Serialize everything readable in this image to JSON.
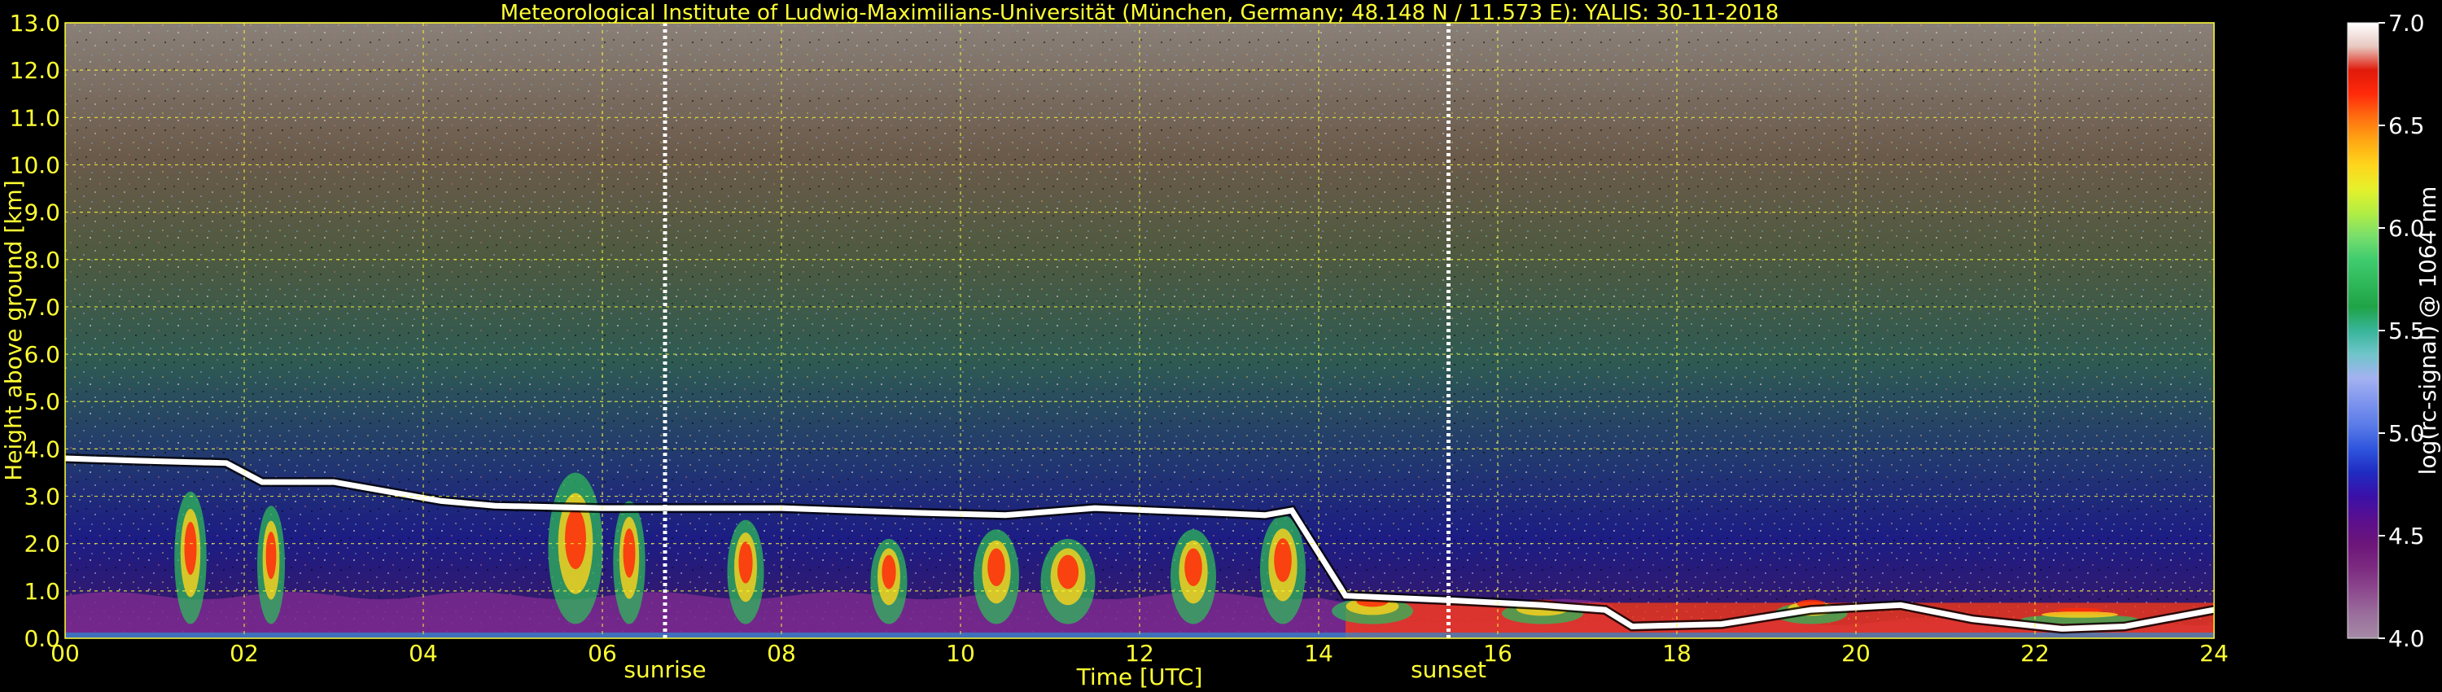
{
  "chart_data": {
    "type": "heatmap",
    "title": "Meteorological Institute of Ludwig-Maximilians-Universität (München, Germany; 48.148 N / 11.573 E):    YALIS: 30-11-2018",
    "xlabel": "Time [UTC]",
    "ylabel": "Height above ground [km]",
    "x_range": [
      0,
      24
    ],
    "y_range": [
      0,
      13
    ],
    "x_ticks": [
      "00",
      "02",
      "04",
      "06",
      "08",
      "10",
      "12",
      "14",
      "16",
      "18",
      "20",
      "22",
      "24"
    ],
    "y_ticks": [
      "0.0",
      "1.0",
      "2.0",
      "3.0",
      "4.0",
      "5.0",
      "6.0",
      "7.0",
      "8.0",
      "9.0",
      "10.0",
      "11.0",
      "12.0",
      "13.0"
    ],
    "grid": true,
    "colorbar": {
      "label": "log(rc-signal) @ 1064 nm",
      "range": [
        4.0,
        7.0
      ],
      "ticks": [
        "4.0",
        "4.5",
        "5.0",
        "5.5",
        "6.0",
        "6.5",
        "7.0"
      ],
      "colors": [
        "#a58aa5",
        "#9a6f9c",
        "#8d4a8e",
        "#7b2a80",
        "#6c157a",
        "#5a0f8e",
        "#3a10a8",
        "#1f2bc2",
        "#2f55dd",
        "#5b7be8",
        "#7f95ee",
        "#a3b2f1",
        "#6fc5c9",
        "#38b59a",
        "#1fa347",
        "#2fb85a",
        "#3fcc6f",
        "#7adf6b",
        "#b4ee43",
        "#e6f02a",
        "#ffd51c",
        "#ffa813",
        "#ff6f10",
        "#ff2a0a",
        "#e01a0a",
        "#e8c8c0",
        "#ffffff"
      ]
    },
    "events": [
      {
        "label": "sunrise",
        "x": 6.7
      },
      {
        "label": "sunset",
        "x": 15.45
      }
    ],
    "features": {
      "cloud_top_km": [
        [
          0.0,
          3.8
        ],
        [
          0.8,
          3.75
        ],
        [
          1.8,
          3.7
        ],
        [
          2.2,
          3.3
        ],
        [
          3.0,
          3.3
        ],
        [
          4.2,
          2.9
        ],
        [
          4.8,
          2.8
        ],
        [
          6.0,
          2.75
        ],
        [
          7.0,
          2.75
        ],
        [
          8.0,
          2.75
        ],
        [
          9.5,
          2.65
        ],
        [
          10.5,
          2.6
        ],
        [
          11.5,
          2.75
        ],
        [
          12.8,
          2.65
        ],
        [
          13.4,
          2.6
        ],
        [
          13.7,
          2.7
        ],
        [
          14.3,
          0.9
        ],
        [
          15.5,
          0.8
        ],
        [
          16.5,
          0.7
        ],
        [
          17.2,
          0.6
        ],
        [
          17.5,
          0.25
        ],
        [
          18.5,
          0.3
        ],
        [
          19.5,
          0.6
        ],
        [
          20.5,
          0.7
        ],
        [
          21.3,
          0.4
        ],
        [
          22.3,
          0.2
        ],
        [
          23.0,
          0.25
        ],
        [
          24.0,
          0.6
        ]
      ],
      "hot_plumes": [
        [
          1.4,
          2.8,
          0.25
        ],
        [
          2.3,
          2.5,
          0.2
        ],
        [
          5.7,
          3.2,
          0.5
        ],
        [
          6.3,
          2.6,
          0.25
        ],
        [
          7.6,
          2.2,
          0.3
        ],
        [
          9.2,
          1.8,
          0.3
        ],
        [
          10.4,
          2.0,
          0.4
        ],
        [
          11.2,
          1.8,
          0.5
        ],
        [
          12.6,
          2.0,
          0.4
        ],
        [
          13.6,
          2.3,
          0.4
        ],
        [
          14.6,
          0.55,
          0.8
        ],
        [
          16.5,
          0.45,
          0.8
        ],
        [
          19.5,
          0.45,
          0.7
        ],
        [
          22.5,
          0.2,
          1.2
        ]
      ]
    }
  }
}
